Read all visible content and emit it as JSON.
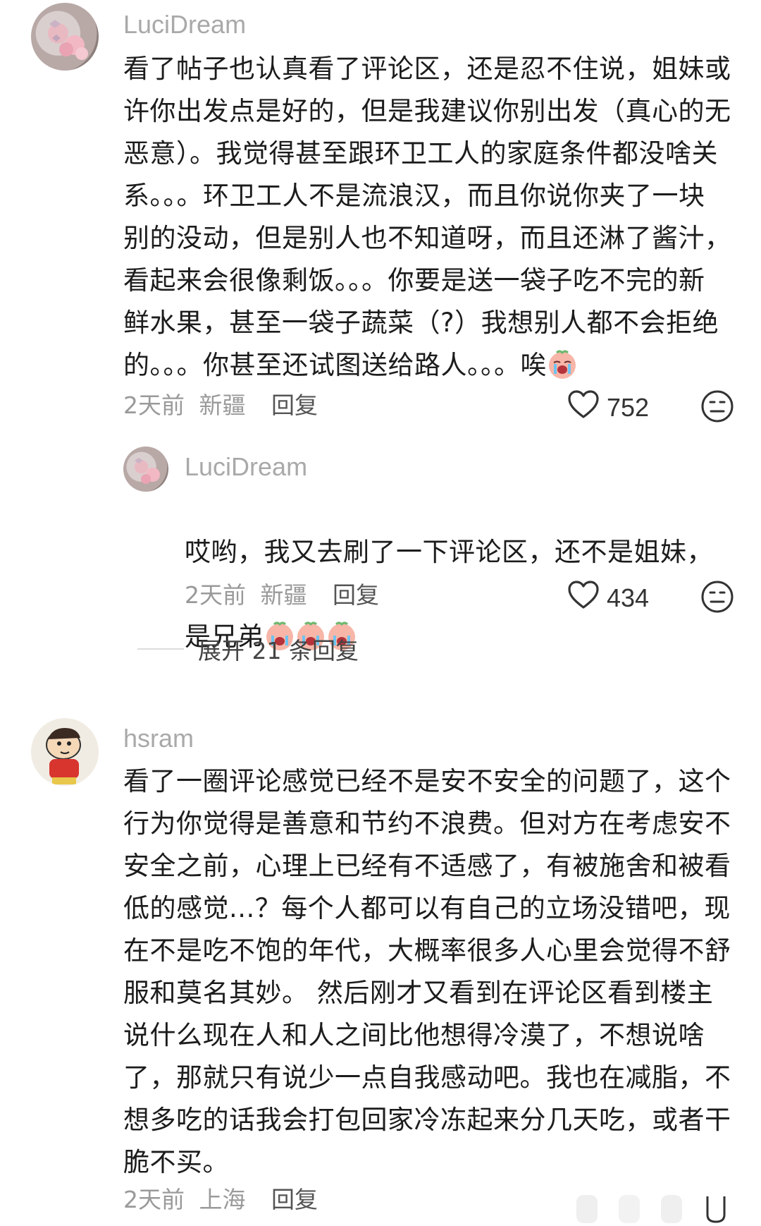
{
  "comments": [
    {
      "username": "LuciDream",
      "text": "看了帖子也认真看了评论区，还是忍不住说，姐妹或\n许你出发点是好的，但是我建议你别出发（真心的无\n恶意）。我觉得甚至跟环卫工人的家庭条件都没啥关\n系。。。环卫工人不是流浪汉，而且你说你夹了一块\n别的没动，但是别人也不知道呀，而且还淋了酱汁，\n看起来会很像剩饭。。。你要是送一袋子吃不完的新\n鲜水果，甚至一袋子蔬菜（?）我想别人都不会拒绝\n的。。。你甚至还试图送给路人。。。唉",
      "time": "2天前",
      "location": "新疆",
      "reply_label": "回复",
      "likes": "752"
    },
    {
      "username": "LuciDream",
      "text_line1": "哎哟，我又去刷了一下评论区，还不是姐妹，",
      "text_line2": "是兄弟",
      "time": "2天前",
      "location": "新疆",
      "reply_label": "回复",
      "likes": "434"
    },
    {
      "username": "hsram",
      "text": "看了一圈评论感觉已经不是安不安全的问题了，这个\n行为你觉得是善意和节约不浪费。但对方在考虑安不\n安全之前，心理上已经有不适感了，有被施舍和被看\n低的感觉...？每个人都可以有自己的立场没错吧，现\n在不是吃不饱的年代，大概率很多人心里会觉得不舒\n服和莫名其妙。 然后刚才又看到在评论区看到楼主\n说什么现在人和人之间比他想得冷漠了，不想说啥\n了，那就只有说少一点自我感动吧。我也在减脂，不\n想多吃的话我会打包回家冷冻起来分几天吃，或者干\n脆不买。",
      "time": "2天前",
      "location": "上海",
      "reply_label": "回复"
    }
  ],
  "expand_replies": "展开 21 条回复",
  "icons": {
    "like": "heart-icon",
    "dislike": "dislike-face-icon",
    "emoji": "crying-face-emoji"
  }
}
